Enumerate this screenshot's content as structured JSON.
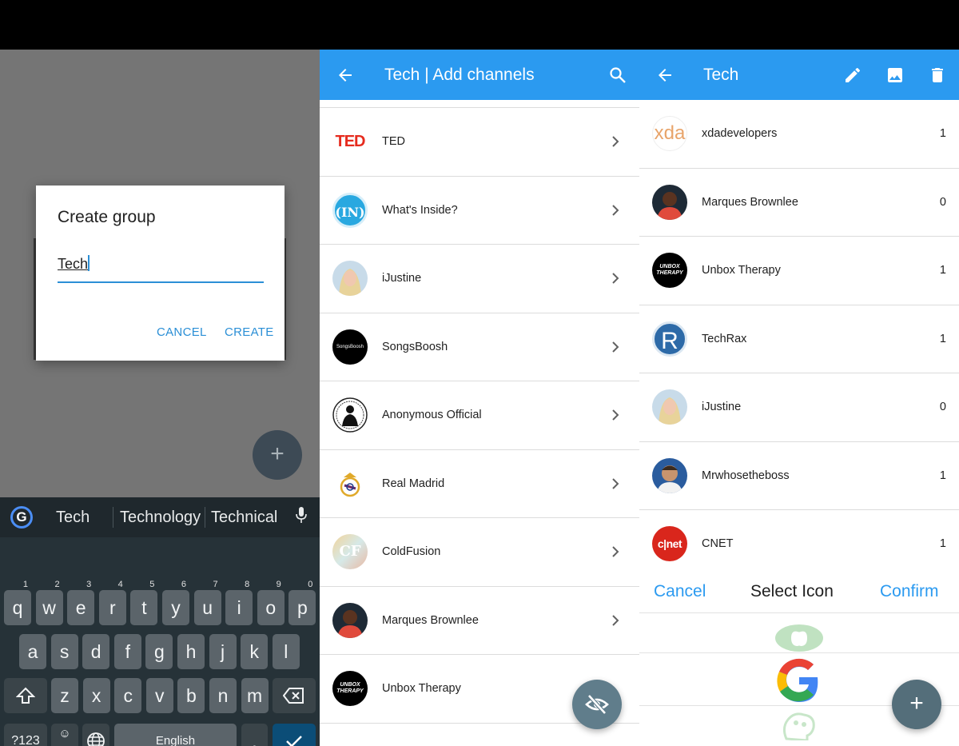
{
  "create_group": {
    "title": "Create group",
    "input_value": "Tech",
    "cancel": "CANCEL",
    "create": "CREATE",
    "fab_symbol": "+"
  },
  "keyboard": {
    "suggestions": [
      "Tech",
      "Technology",
      "Technical"
    ],
    "row1": [
      {
        "k": "q",
        "h": "1"
      },
      {
        "k": "w",
        "h": "2"
      },
      {
        "k": "e",
        "h": "3"
      },
      {
        "k": "r",
        "h": "4"
      },
      {
        "k": "t",
        "h": "5"
      },
      {
        "k": "y",
        "h": "6"
      },
      {
        "k": "u",
        "h": "7"
      },
      {
        "k": "i",
        "h": "8"
      },
      {
        "k": "o",
        "h": "9"
      },
      {
        "k": "p",
        "h": "0"
      }
    ],
    "row2": [
      "a",
      "s",
      "d",
      "f",
      "g",
      "h",
      "j",
      "k",
      "l"
    ],
    "row3": [
      "z",
      "x",
      "c",
      "v",
      "b",
      "n",
      "m"
    ],
    "symbols": "?123",
    "emoji_top": "☺",
    "emoji_bottom": ",",
    "space": "English",
    "period": "."
  },
  "add_channels": {
    "title": "Tech | Add channels",
    "channels": [
      {
        "name": "TED",
        "avatar": "ted-logo"
      },
      {
        "name": "What's Inside?",
        "avatar": "in-logo"
      },
      {
        "name": "iJustine",
        "avatar": "photo-blonde"
      },
      {
        "name": "SongsBoosh",
        "avatar": "songsboosh-logo"
      },
      {
        "name": "Anonymous Official",
        "avatar": "anonymous-logo"
      },
      {
        "name": "Real Madrid",
        "avatar": "real-madrid-crest"
      },
      {
        "name": "ColdFusion",
        "avatar": "cf-logo"
      },
      {
        "name": "Marques Brownlee",
        "avatar": "photo-man"
      },
      {
        "name": "Unbox Therapy",
        "avatar": "unbox-therapy-logo"
      }
    ],
    "logo_texts": {
      "ted": "TED",
      "in": "(IN)",
      "songsboosh": "SongsBoosh",
      "cf": "CF",
      "unbox1": "UNBOX",
      "unbox2": "THERAPY"
    }
  },
  "group_detail": {
    "title": "Tech",
    "channels": [
      {
        "name": "xdadevelopers",
        "count": "1"
      },
      {
        "name": "Marques Brownlee",
        "count": "0"
      },
      {
        "name": "Unbox Therapy",
        "count": "1"
      },
      {
        "name": "TechRax",
        "count": "1"
      },
      {
        "name": "iJustine",
        "count": "0"
      },
      {
        "name": "Mrwhosetheboss",
        "count": "1"
      },
      {
        "name": "CNET",
        "count": "1"
      }
    ],
    "logo_texts": {
      "xda": "xda",
      "techrax": "R",
      "cnet": "c|net",
      "unbox1": "UNBOX",
      "unbox2": "THERAPY"
    },
    "picker": {
      "cancel": "Cancel",
      "title": "Select Icon",
      "confirm": "Confirm"
    },
    "fab_symbol": "+"
  },
  "colors": {
    "accent": "#2b9af0",
    "dialog_accent": "#2b8fd6",
    "fab": "#546e7a"
  }
}
